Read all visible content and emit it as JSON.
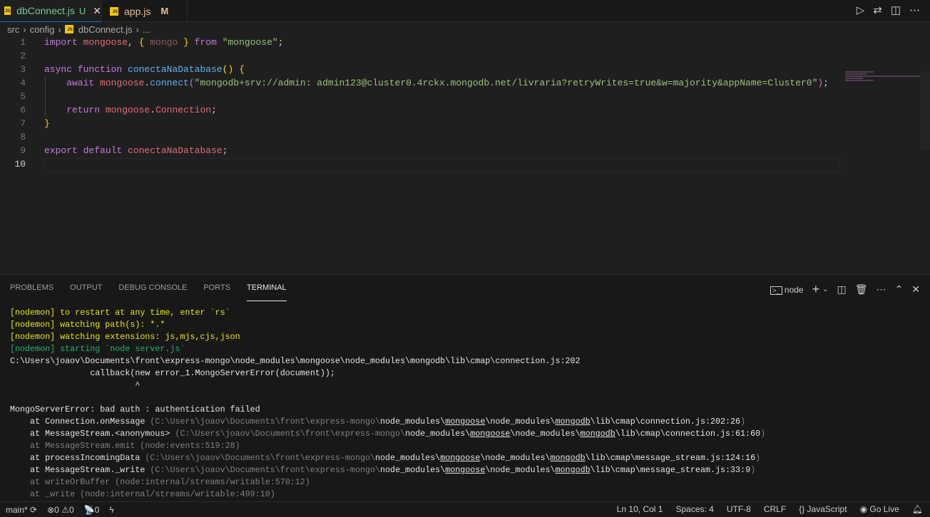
{
  "tabs": [
    {
      "label": "dbConnect.js",
      "badge": "U",
      "active": true
    },
    {
      "label": "app.js",
      "badge": "M",
      "active": false
    }
  ],
  "breadcrumb": [
    "src",
    "config",
    "dbConnect.js",
    "..."
  ],
  "code": [
    [
      [
        "import ",
        "kw"
      ],
      [
        "mongoose",
        "var"
      ],
      [
        ", ",
        "pl"
      ],
      [
        "{ ",
        "br"
      ],
      [
        "mongo",
        "var2"
      ],
      [
        " }",
        "br"
      ],
      [
        " from ",
        "kw"
      ],
      [
        "\"mongoose\"",
        "str"
      ],
      [
        ";",
        "pl"
      ]
    ],
    [],
    [
      [
        "async ",
        "kw"
      ],
      [
        "function ",
        "kw"
      ],
      [
        "conectaNaDatabase",
        "fn"
      ],
      [
        "()",
        "br"
      ],
      [
        " {",
        "br"
      ]
    ],
    [
      [
        "    await ",
        "kw"
      ],
      [
        "mongoose",
        "var"
      ],
      [
        ".",
        "pl"
      ],
      [
        "connect",
        "fn"
      ],
      [
        "(",
        "br2"
      ],
      [
        "\"mongodb+srv://admin: admin123@cluster0.4rckx.mongodb.net/livraria?retryWrites=true&w=majority&appName=Cluster0\"",
        "str"
      ],
      [
        ")",
        "br2"
      ],
      [
        ";",
        "pl"
      ]
    ],
    [],
    [
      [
        "    return ",
        "kw"
      ],
      [
        "mongoose",
        "var"
      ],
      [
        ".",
        "pl"
      ],
      [
        "Connection",
        "var"
      ],
      [
        ";",
        "pl"
      ]
    ],
    [
      [
        "}",
        "br"
      ]
    ],
    [],
    [
      [
        "export ",
        "kw"
      ],
      [
        "default ",
        "kw"
      ],
      [
        "conectaNaDatabase",
        "var"
      ],
      [
        ";",
        "pl"
      ]
    ],
    []
  ],
  "current_line": 10,
  "panel": {
    "tabs": [
      "PROBLEMS",
      "OUTPUT",
      "DEBUG CONSOLE",
      "PORTS",
      "TERMINAL"
    ],
    "active": "TERMINAL",
    "shell": "node"
  },
  "terminal": [
    [
      [
        "[nodemon] to restart at any time, enter `rs`",
        "y"
      ]
    ],
    [
      [
        "[nodemon] watching path(s): *.*",
        "y"
      ]
    ],
    [
      [
        "[nodemon] watching extensions: js,mjs,cjs,json",
        "y"
      ]
    ],
    [
      [
        "[nodemon] starting `node server.js`",
        "g"
      ]
    ],
    [
      [
        "C:\\Users\\joaov\\Documents\\front\\express-mongo\\node_modules\\mongoose\\node_modules\\mongodb\\lib\\cmap\\connection.js:202",
        "w"
      ]
    ],
    [
      [
        "                callback(new error_1.MongoServerError(document));",
        "w"
      ]
    ],
    [
      [
        "                         ^",
        "w"
      ]
    ],
    [],
    [
      [
        "MongoServerError: bad auth : authentication failed",
        "w"
      ]
    ],
    [
      [
        "    at Connection.onMessage ",
        "w"
      ],
      [
        "(C:\\Users\\joaov\\Documents\\front\\express-mongo\\",
        "d"
      ],
      [
        "node_modules\\",
        "w"
      ],
      [
        "mongoose",
        "u"
      ],
      [
        "\\node_modules\\",
        "w"
      ],
      [
        "mongodb",
        "u"
      ],
      [
        "\\lib\\cmap\\connection.js:202:26",
        "w"
      ],
      [
        ")",
        "d"
      ]
    ],
    [
      [
        "    at MessageStream.<anonymous> ",
        "w"
      ],
      [
        "(C:\\Users\\joaov\\Documents\\front\\express-mongo\\",
        "d"
      ],
      [
        "node_modules\\",
        "w"
      ],
      [
        "mongoose",
        "u"
      ],
      [
        "\\node_modules\\",
        "w"
      ],
      [
        "mongodb",
        "u"
      ],
      [
        "\\lib\\cmap\\connection.js:61:60",
        "w"
      ],
      [
        ")",
        "d"
      ]
    ],
    [
      [
        "    at MessageStream.emit (node:events:519:28)",
        "d"
      ]
    ],
    [
      [
        "    at processIncomingData ",
        "w"
      ],
      [
        "(C:\\Users\\joaov\\Documents\\front\\express-mongo\\",
        "d"
      ],
      [
        "node_modules\\",
        "w"
      ],
      [
        "mongoose",
        "u"
      ],
      [
        "\\node_modules\\",
        "w"
      ],
      [
        "mongodb",
        "u"
      ],
      [
        "\\lib\\cmap\\message_stream.js:124:16",
        "w"
      ],
      [
        ")",
        "d"
      ]
    ],
    [
      [
        "    at MessageStream._write ",
        "w"
      ],
      [
        "(C:\\Users\\joaov\\Documents\\front\\express-mongo\\",
        "d"
      ],
      [
        "node_modules\\",
        "w"
      ],
      [
        "mongoose",
        "u"
      ],
      [
        "\\node_modules\\",
        "w"
      ],
      [
        "mongodb",
        "u"
      ],
      [
        "\\lib\\cmap\\message_stream.js:33:9",
        "w"
      ],
      [
        ")",
        "d"
      ]
    ],
    [
      [
        "    at writeOrBuffer (node:internal/streams/writable:570:12)",
        "d"
      ]
    ],
    [
      [
        "    at _write (node:internal/streams/writable:499:10)",
        "d"
      ]
    ]
  ],
  "status": {
    "branch": "main*",
    "errors": "0",
    "warnings": "0",
    "ports": "0",
    "position": "Ln 10, Col 1",
    "spaces": "Spaces: 4",
    "encoding": "UTF-8",
    "eol": "CRLF",
    "language": "JavaScript",
    "golive": "Go Live"
  }
}
